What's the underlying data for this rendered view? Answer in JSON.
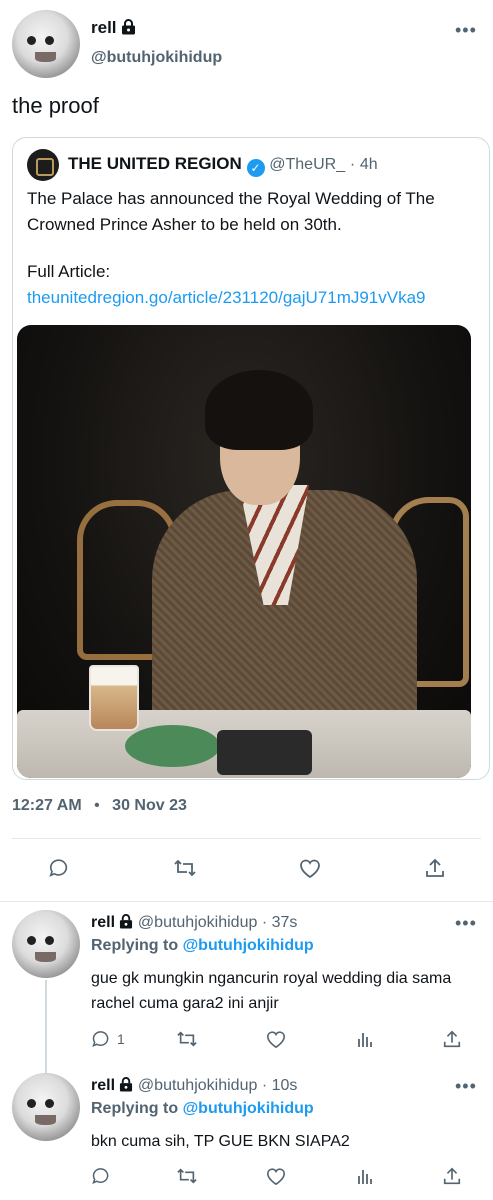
{
  "main_tweet": {
    "display_name": "rell",
    "handle": "@butuhjokihidup",
    "text": "the proof",
    "timestamp": "12:27 AM",
    "date": "30 Nov 23",
    "more_label": "•••"
  },
  "quoted_tweet": {
    "display_name": "THE UNITED REGION",
    "verified_mark": "✓",
    "handle": "@TheUR_",
    "separator": "·",
    "age": "4h",
    "text": "The Palace has announced the Royal Wedding of The Crowned Prince Asher to be held on 30th.",
    "full_article_label": "Full Article:",
    "link": "theunitedregion.go/article/231120/gajU71mJ91vVka9"
  },
  "replies": [
    {
      "display_name": "rell",
      "handle": "@butuhjokihidup",
      "separator": "·",
      "age": "37s",
      "replying_label": "Replying to",
      "replying_handle": "@butuhjokihidup",
      "text": "gue gk mungkin ngancurin royal wedding dia sama rachel cuma gara2 ini anjir",
      "reply_count": "1"
    },
    {
      "display_name": "rell",
      "handle": "@butuhjokihidup",
      "separator": "·",
      "age": "10s",
      "replying_label": "Replying to",
      "replying_handle": "@butuhjokihidup",
      "text": "bkn cuma sih, TP GUE BKN SIAPA2",
      "reply_count": ""
    }
  ],
  "icons": [
    "lock-icon",
    "reply-icon",
    "retweet-icon",
    "like-icon",
    "share-icon",
    "views-icon",
    "verified-icon"
  ],
  "colors": {
    "accent": "#1d9bf0",
    "muted": "#536471",
    "text": "#0f1419",
    "border": "#cfd9de"
  }
}
